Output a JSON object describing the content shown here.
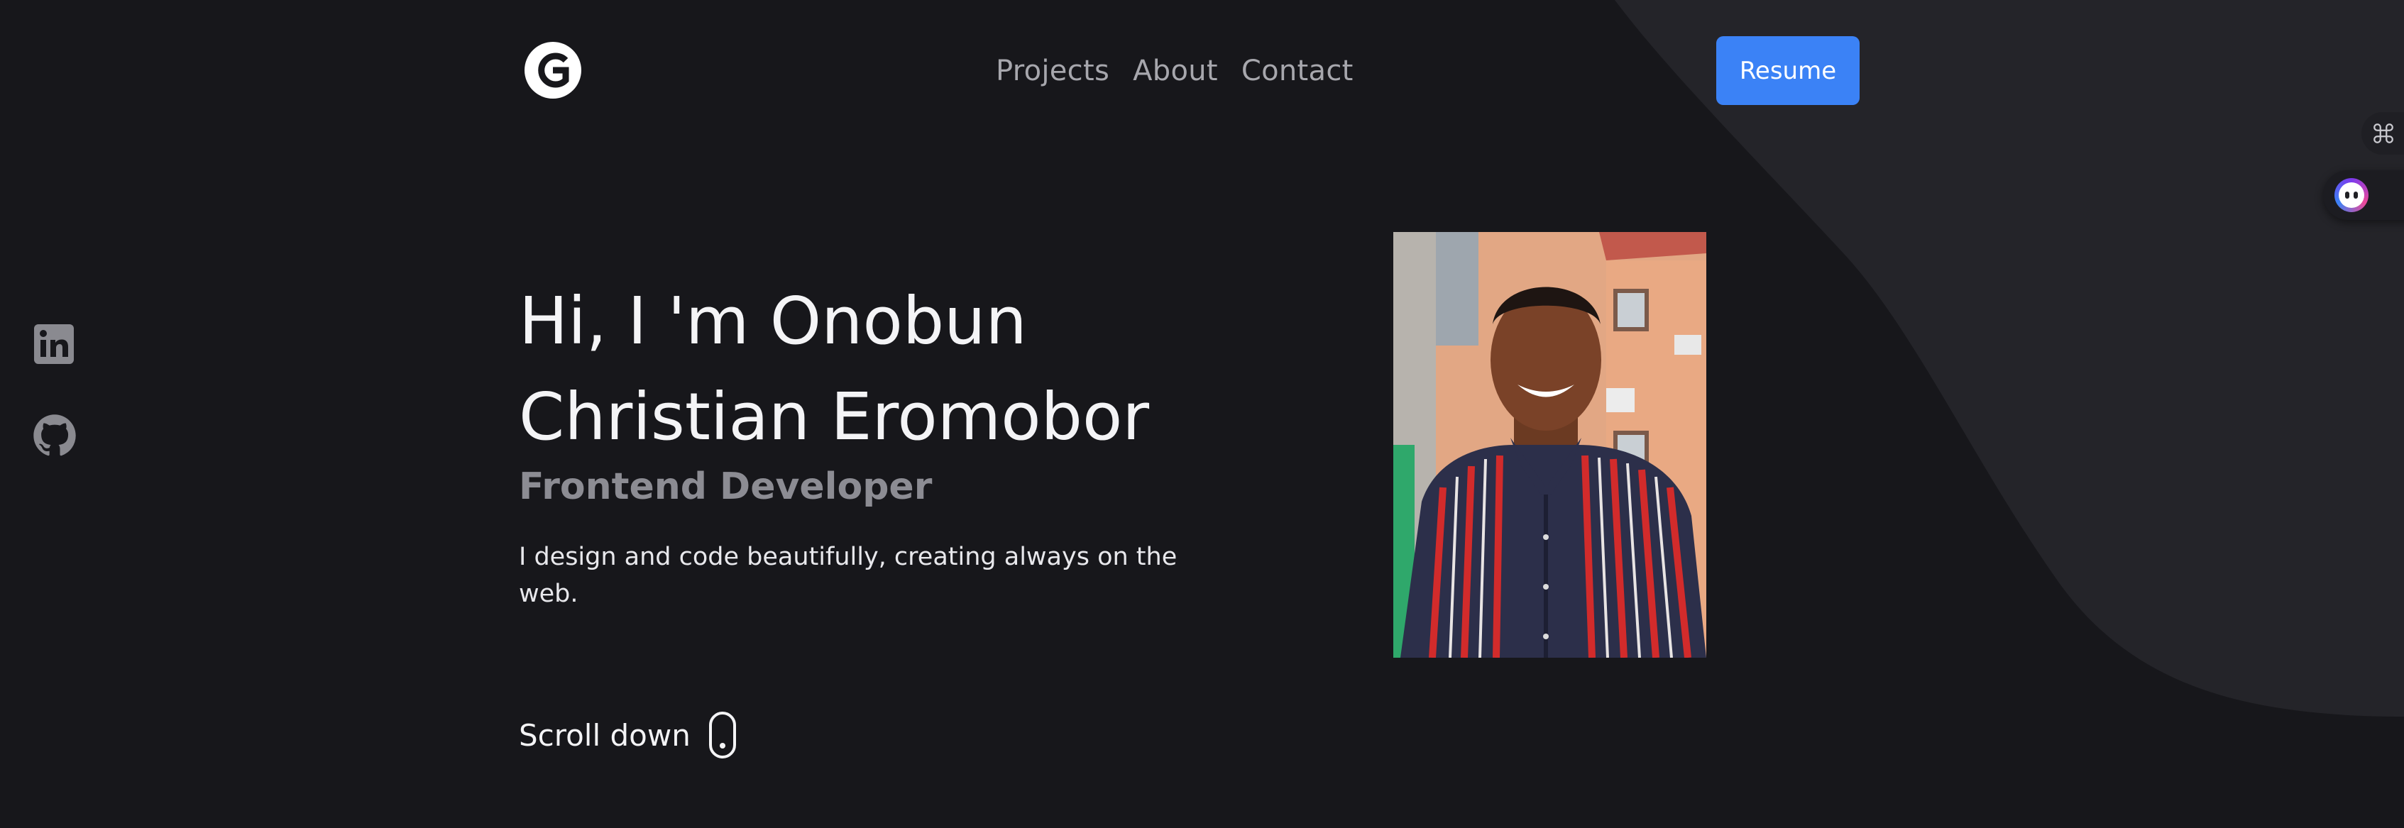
{
  "header": {
    "logo_letter": "G",
    "nav": [
      {
        "label": "Projects"
      },
      {
        "label": "About"
      },
      {
        "label": "Contact"
      }
    ],
    "resume_label": "Resume"
  },
  "social": {
    "icons": [
      "linkedin-icon",
      "github-icon"
    ]
  },
  "hero": {
    "title_line1": "Hi, I 'm Onobun",
    "title_line2": "Christian Eromobor",
    "subtitle": "Frontend Developer",
    "description": "I design and code beautifully, creating always on the web.",
    "scroll_label": "Scroll down"
  },
  "widgets": {
    "command_icon": "command-icon",
    "assistant_icon": "bot-assistant-icon"
  },
  "colors": {
    "background": "#17171b",
    "blob": "#242429",
    "accent": "#3b82f6",
    "nav_text": "#a7a7ad",
    "subtitle_text": "#8c8c93"
  }
}
